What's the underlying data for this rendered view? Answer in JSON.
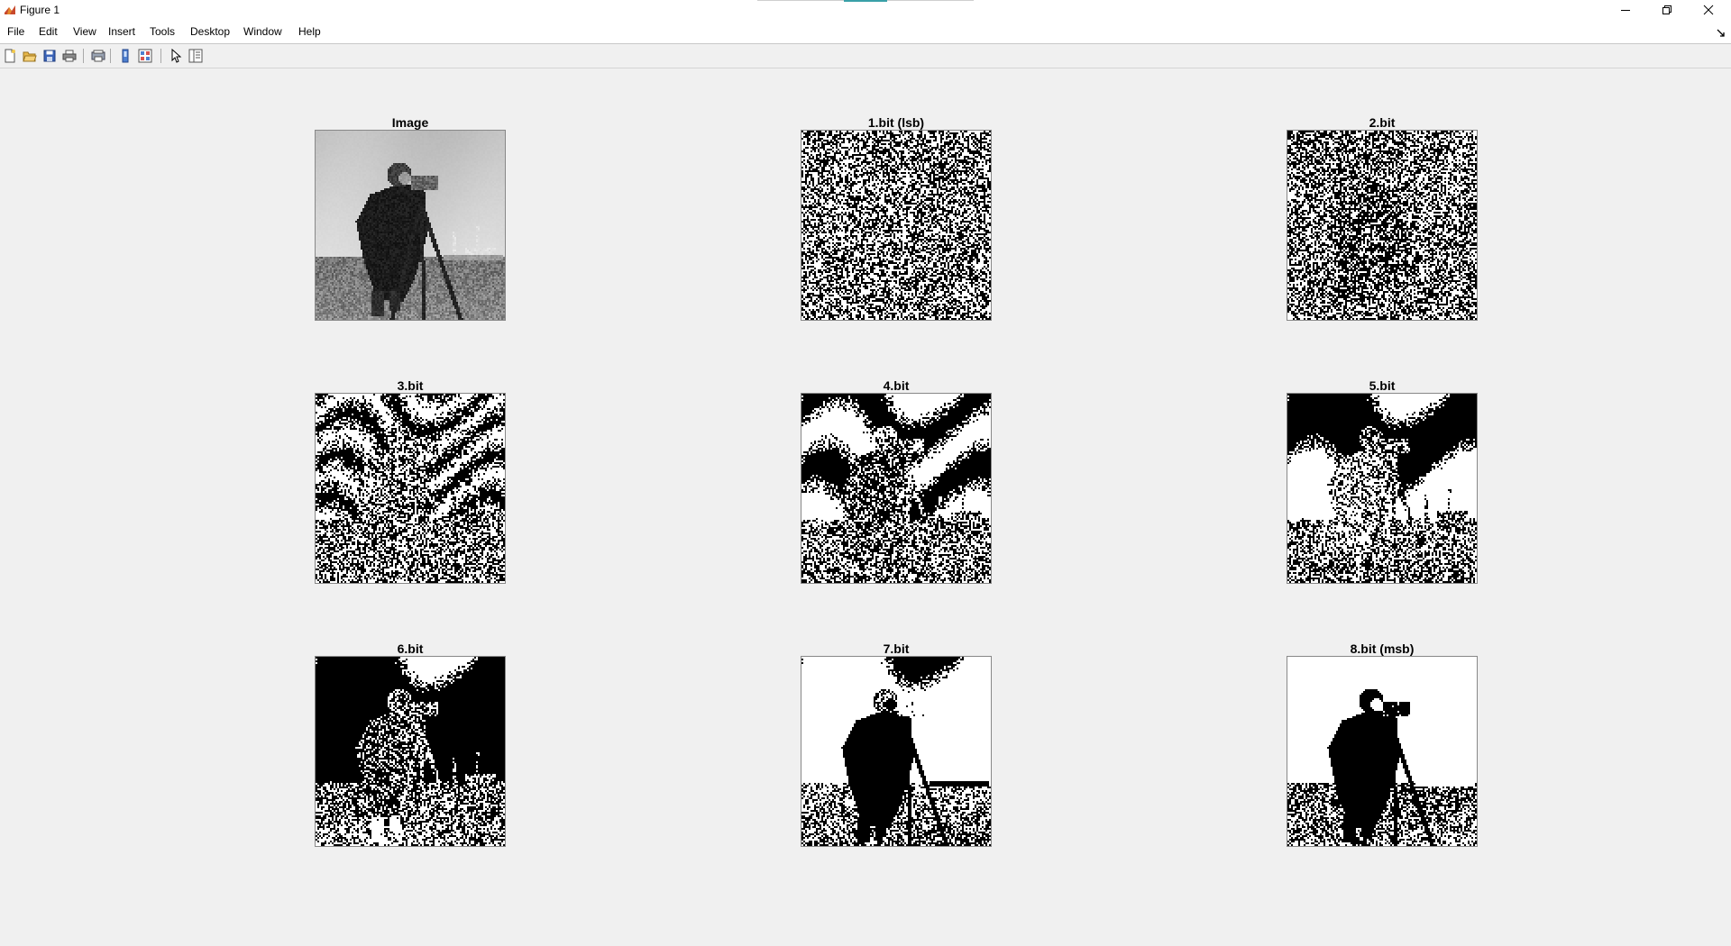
{
  "window": {
    "title": "Figure 1",
    "app_icon": "matlab-icon",
    "controls": {
      "minimize": "minimize-icon",
      "maximize": "restore-icon",
      "close": "close-icon"
    }
  },
  "menu": {
    "items": [
      "File",
      "Edit",
      "View",
      "Insert",
      "Tools",
      "Desktop",
      "Window",
      "Help"
    ]
  },
  "toolbar": {
    "buttons": [
      "new-figure-icon",
      "open-file-icon",
      "save-icon",
      "print-icon",
      "print-preview-icon",
      "link-plot-icon",
      "data-cursor-icon",
      "edit-plot-arrow-icon",
      "property-inspector-icon"
    ]
  },
  "subplots": [
    {
      "title": "Image",
      "kind": "gray"
    },
    {
      "title": "1.bit (lsb)",
      "kind": "noise",
      "density": 0.5
    },
    {
      "title": "2.bit",
      "kind": "noise",
      "density": 0.48
    },
    {
      "title": "3.bit",
      "kind": "bitplane",
      "bit": 3
    },
    {
      "title": "4.bit",
      "kind": "bitplane",
      "bit": 4
    },
    {
      "title": "5.bit",
      "kind": "bitplane",
      "bit": 5
    },
    {
      "title": "6.bit",
      "kind": "bitplane",
      "bit": 6
    },
    {
      "title": "7.bit",
      "kind": "bitplane",
      "bit": 7
    },
    {
      "title": "8.bit (msb)",
      "kind": "bitplane",
      "bit": 8
    }
  ]
}
